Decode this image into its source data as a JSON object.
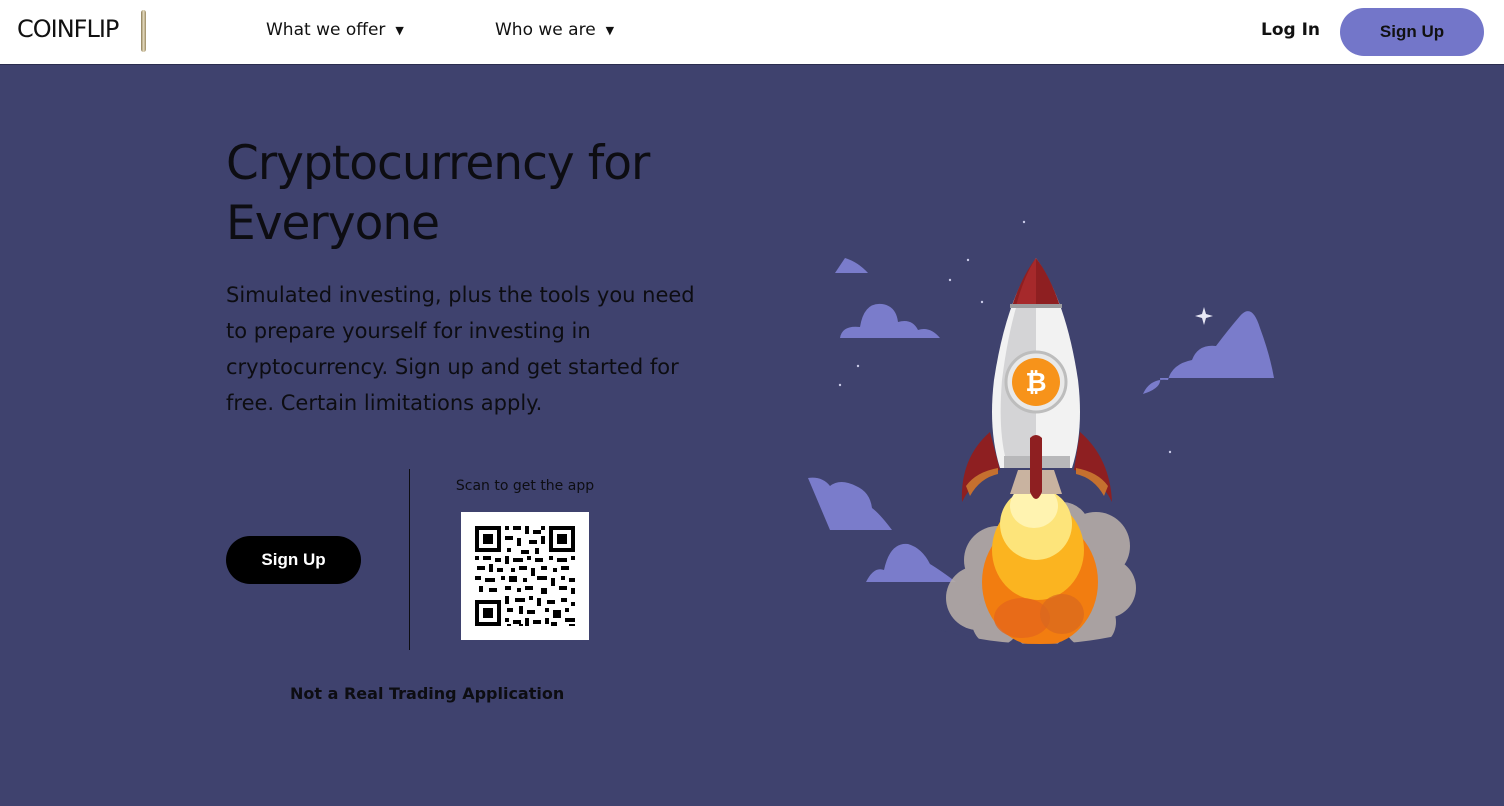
{
  "header": {
    "logo_text": "COINFLIP",
    "nav": [
      {
        "label": "What we offer"
      },
      {
        "label": "Who we are"
      }
    ],
    "login_label": "Log In",
    "signup_label": "Sign Up"
  },
  "hero": {
    "title": "Cryptocurrency for Everyone",
    "subtitle": "Simulated investing, plus the tools you need to prepare yourself for investing in cryptocurrency. Sign up and get started for free. Certain limitations apply.",
    "signup_label": "Sign Up",
    "scan_label": "Scan to get the app",
    "disclaimer": "Not a Real Trading Application"
  },
  "colors": {
    "background": "#3f426e",
    "accent": "#7376c9",
    "header_bg": "#ffffff",
    "rocket_red": "#8e1f21",
    "bitcoin_orange": "#f7931a"
  },
  "icons": {
    "dropdown": "caret-down-icon",
    "illustration": "rocket-bitcoin-illustration",
    "qr": "qr-code"
  }
}
